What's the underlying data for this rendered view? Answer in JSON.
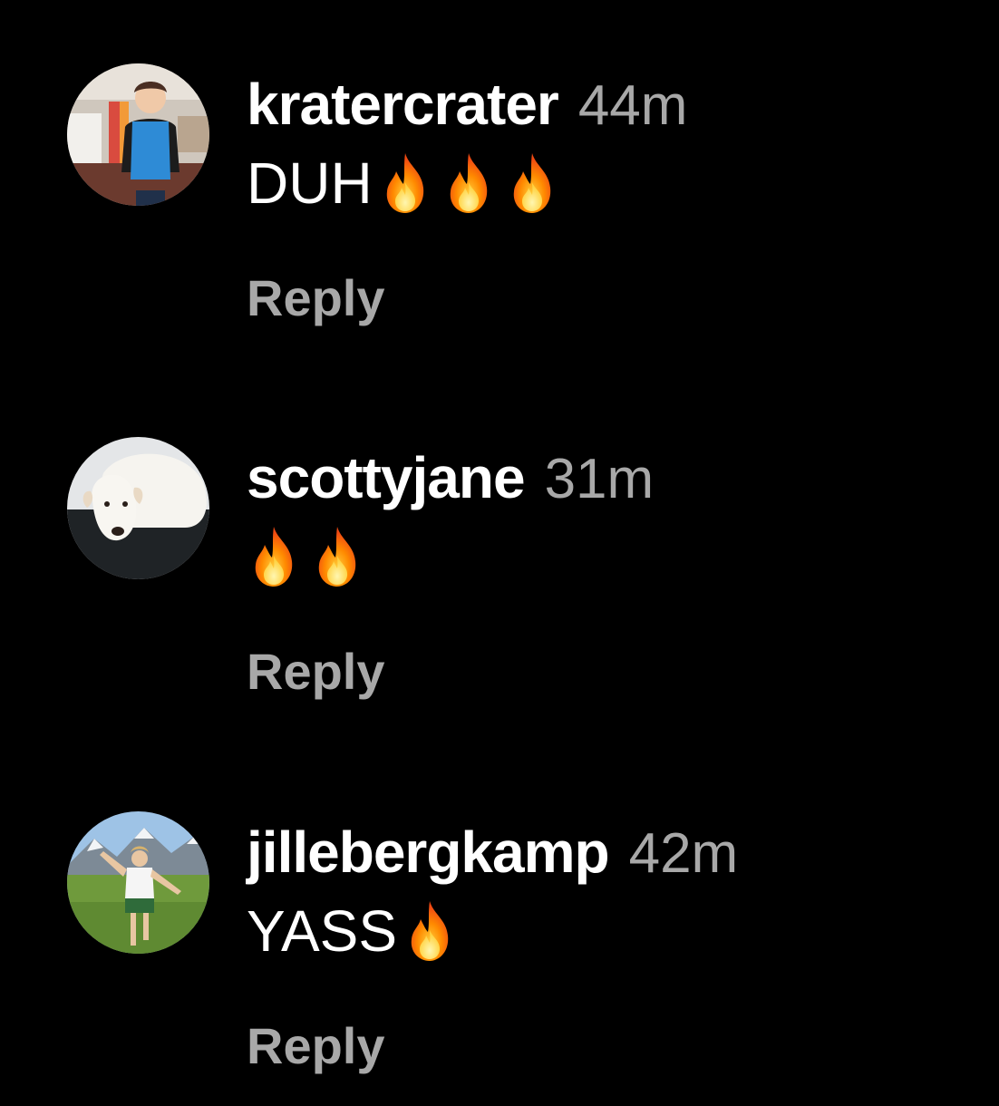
{
  "comments": [
    {
      "username": "kratercrater",
      "time": "44m",
      "text": "DUH",
      "fire_count": 3,
      "reply_label": "Reply",
      "avatar_icon": "person-in-apron-avatar"
    },
    {
      "username": "scottyjane",
      "time": "31m",
      "text": "",
      "fire_count": 2,
      "reply_label": "Reply",
      "avatar_icon": "white-dog-avatar"
    },
    {
      "username": "jillebergkamp",
      "time": "42m",
      "text": "YASS",
      "fire_count": 1,
      "reply_label": "Reply",
      "avatar_icon": "person-on-meadow-avatar"
    }
  ],
  "colors": {
    "background": "#000000",
    "primary_text": "#ffffff",
    "secondary_text": "#a8a8a8"
  },
  "icons": {
    "reaction": "fire-emoji-icon"
  }
}
